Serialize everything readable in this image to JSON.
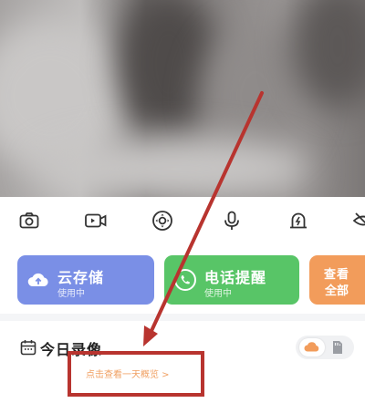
{
  "toolbar": {
    "icons": [
      "camera-icon",
      "video-record-icon",
      "ptz-control-icon",
      "microphone-icon",
      "alarm-light-icon",
      "eye-off-icon"
    ]
  },
  "cards": [
    {
      "title": "云存储",
      "subtitle": "使用中",
      "color": "#7a8fe6",
      "icon": "cloud-upload-icon"
    },
    {
      "title": "电话提醒",
      "subtitle": "使用中",
      "color": "#58c567",
      "icon": "phone-call-icon"
    },
    {
      "title_line1": "查看",
      "title_line2": "全部",
      "color": "#f29c5b"
    }
  ],
  "today": {
    "title": "今日录像",
    "hint": "点击查看一天概览 >"
  },
  "annotation": {
    "color": "#b8342f"
  }
}
